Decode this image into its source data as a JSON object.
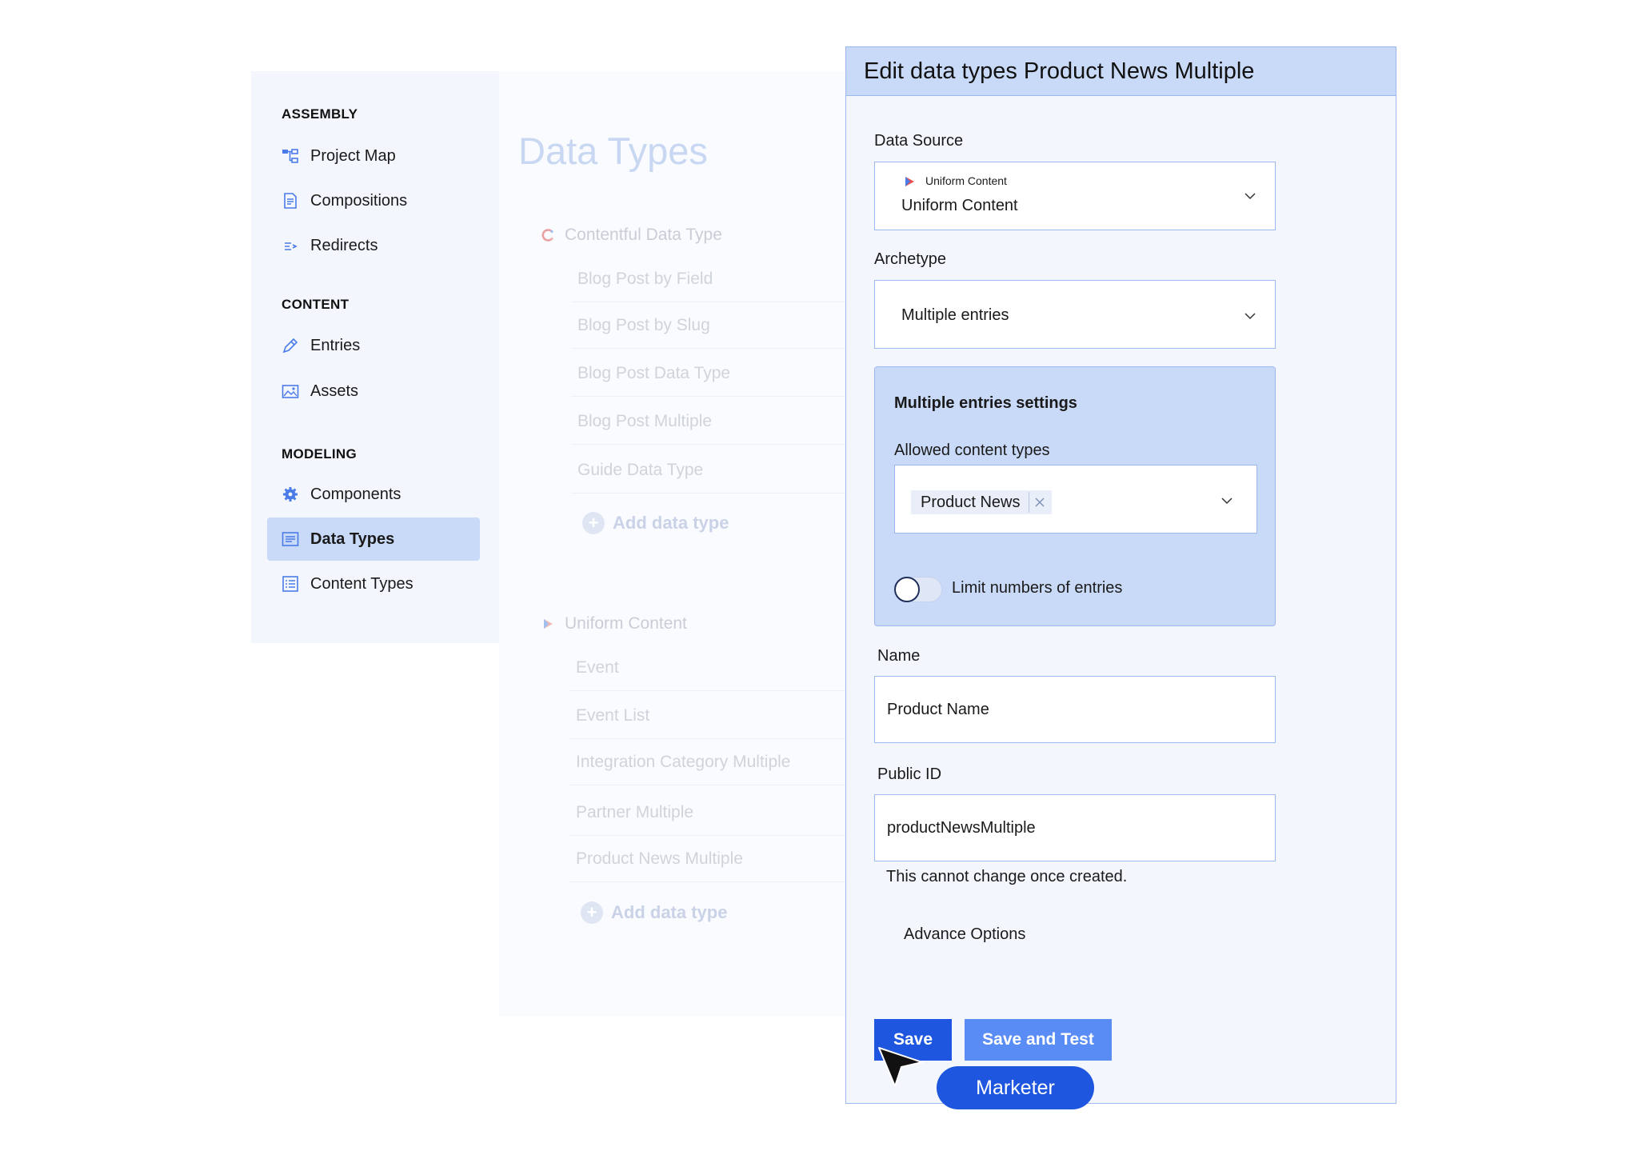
{
  "sidebar": {
    "sections": [
      {
        "title": "ASSEMBLY",
        "items": [
          {
            "label": "Project Map",
            "icon": "project-map-icon"
          },
          {
            "label": "Compositions",
            "icon": "compositions-icon"
          },
          {
            "label": "Redirects",
            "icon": "redirects-icon"
          }
        ]
      },
      {
        "title": "CONTENT",
        "items": [
          {
            "label": "Entries",
            "icon": "pencil-icon"
          },
          {
            "label": "Assets",
            "icon": "image-icon"
          }
        ]
      },
      {
        "title": "MODELING",
        "items": [
          {
            "label": "Components",
            "icon": "gear-icon"
          },
          {
            "label": "Data Types",
            "icon": "data-types-icon",
            "active": true
          },
          {
            "label": "Content Types",
            "icon": "list-icon"
          }
        ]
      }
    ]
  },
  "list": {
    "title": "Data Types",
    "groups": [
      {
        "name": "Contentful Data Type",
        "items": [
          "Blog Post by Field",
          "Blog Post by Slug",
          "Blog Post Data Type",
          "Blog Post Multiple",
          "Guide Data Type"
        ],
        "add_label": "Add data type"
      },
      {
        "name": "Uniform Content",
        "items": [
          "Event",
          "Event List",
          "Integration Category Multiple",
          "Partner Multiple",
          "Product News Multiple"
        ],
        "add_label": "Add data type"
      }
    ]
  },
  "panel": {
    "title": "Edit data types Product News Multiple",
    "data_source": {
      "label": "Data Source",
      "small": "Uniform Content",
      "value": "Uniform Content"
    },
    "archetype": {
      "label": "Archetype",
      "value": "Multiple entries"
    },
    "settings": {
      "title": "Multiple entries settings",
      "allowed_label": "Allowed content types",
      "chip": "Product News",
      "limit_label": "Limit numbers of entries",
      "limit_enabled": false
    },
    "name": {
      "label": "Name",
      "value": "Product Name"
    },
    "public_id": {
      "label": "Public ID",
      "value": "productNewsMultiple",
      "hint": "This cannot change once created."
    },
    "advance": "Advance Options",
    "save": "Save",
    "save_test": "Save and Test"
  },
  "cursor_tag": "Marketer",
  "colors": {
    "accent": "#1e56e0",
    "panel_head": "#c9daf8",
    "border": "#9db7ef"
  }
}
